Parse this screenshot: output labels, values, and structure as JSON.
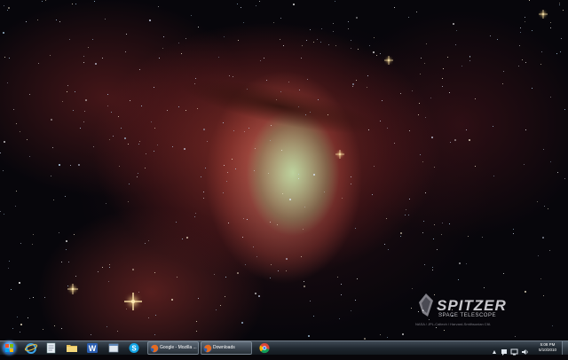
{
  "wallpaper": {
    "logo_name": "SPITZER",
    "logo_subtitle": "SPACE TELESCOPE",
    "credit": "NASA / JPL-Caltech / Harvard-Smithsonian CfA"
  },
  "taskbar": {
    "pinned": [
      {
        "name": "internet-explorer-icon"
      },
      {
        "name": "notepad-icon"
      },
      {
        "name": "windows-explorer-icon"
      },
      {
        "name": "word-icon"
      },
      {
        "name": "window-icon"
      },
      {
        "name": "skype-icon"
      }
    ],
    "tasks": [
      {
        "label": "Google - Mozilla ...",
        "icon": "firefox-icon"
      },
      {
        "label": "Downloads",
        "icon": "firefox-icon"
      }
    ],
    "extra_pinned": {
      "name": "chrome-icon"
    },
    "tray_icons": [
      "expand-tray-icon",
      "action-center-icon",
      "network-icon",
      "volume-icon"
    ],
    "clock_time": "5:08 PM",
    "clock_date": "5/10/2010"
  },
  "colors": {
    "taskbar_top": "#3f4a55",
    "taskbar_bottom": "#141a20",
    "nebula_red": "#a8372d",
    "nebula_green": "#bee6aa"
  }
}
